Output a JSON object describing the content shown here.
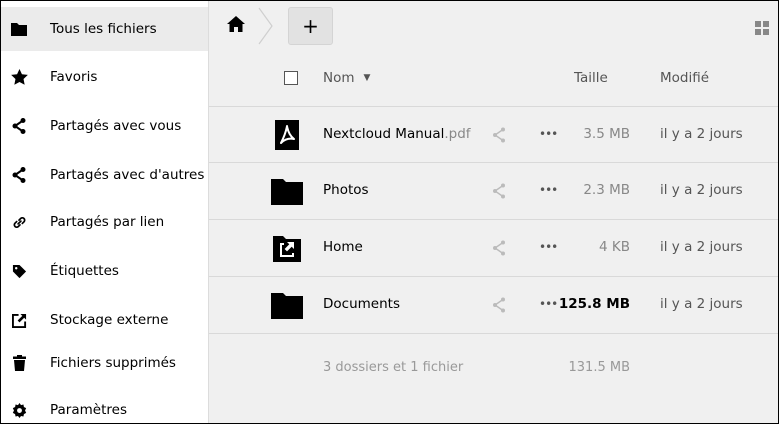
{
  "sidebar": {
    "items": [
      {
        "label": "Tous les fichiers",
        "icon": "folder-icon",
        "active": true
      },
      {
        "label": "Favoris",
        "icon": "star-icon"
      },
      {
        "label": "Partagés avec vous",
        "icon": "share-icon"
      },
      {
        "label": "Partagés avec d'autres",
        "icon": "share-icon"
      },
      {
        "label": "Partagés par lien",
        "icon": "link-icon"
      },
      {
        "label": "Étiquettes",
        "icon": "tag-icon"
      },
      {
        "label": "Stockage externe",
        "icon": "external-icon"
      },
      {
        "label": "Fichiers supprimés",
        "icon": "trash-icon"
      },
      {
        "label": "Paramètres",
        "icon": "gear-icon"
      }
    ]
  },
  "toolbar": {
    "add_label": "+"
  },
  "columns": {
    "name": "Nom",
    "size": "Taille",
    "modified": "Modifié"
  },
  "files": [
    {
      "name": "Nextcloud Manual",
      "ext": ".pdf",
      "size": "3.5 MB",
      "modified": "il y a  2  jours",
      "icon": "pdf-icon"
    },
    {
      "name": "Photos",
      "ext": "",
      "size": "2.3 MB",
      "modified": "il y a  2  jours",
      "icon": "folder-icon"
    },
    {
      "name": "Home",
      "ext": "",
      "size": "4 KB",
      "modified": "il y a  2  jours",
      "icon": "external-folder-icon"
    },
    {
      "name": "Documents",
      "ext": "",
      "size": "125.8 MB",
      "modified": "il y a  2  jours",
      "icon": "folder-icon"
    }
  ],
  "summary": {
    "text": "3 dossiers et 1 fichier",
    "size": "131.5 MB"
  },
  "colors": {
    "active_bg": "#ebebeb",
    "main_bg": "#f0f0f0",
    "muted_text": "#888888"
  }
}
